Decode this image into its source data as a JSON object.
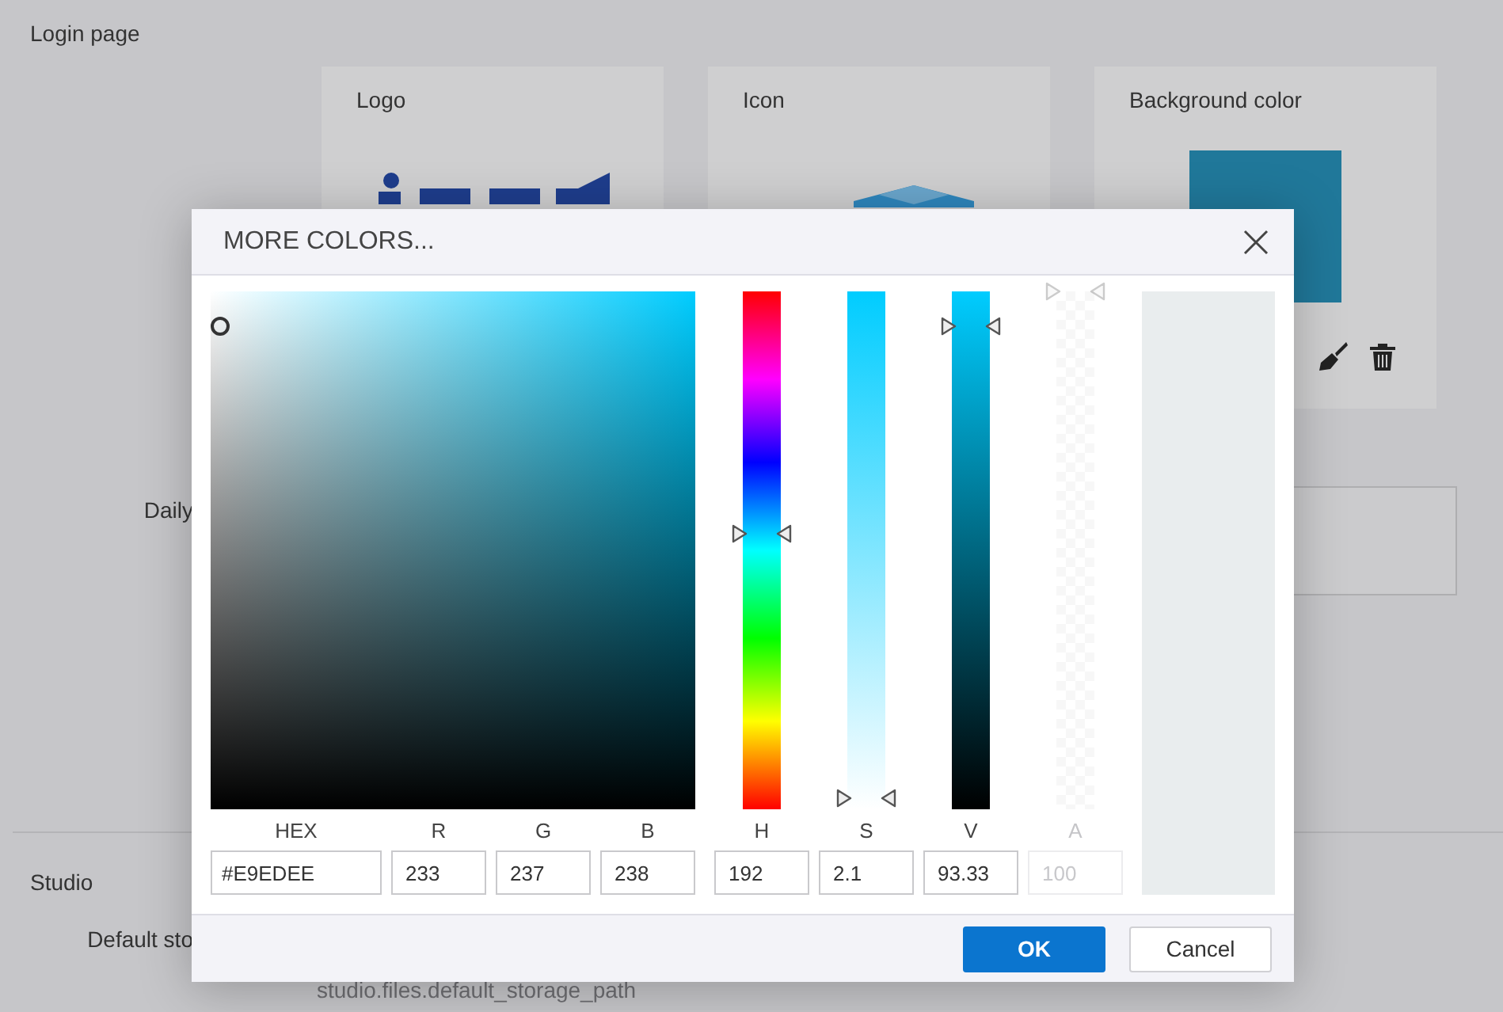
{
  "page": {
    "sections": [
      {
        "title": "Login page",
        "cards": [
          {
            "kind": "logo",
            "title": "Logo"
          },
          {
            "kind": "icon",
            "title": "Icon"
          },
          {
            "kind": "color",
            "title": "Background color",
            "color": "#20789a"
          }
        ],
        "field_label": "Daily"
      },
      {
        "title": "Studio",
        "field_label": "Default sto",
        "field_value": "studio.files.default_storage_path"
      }
    ]
  },
  "dialog": {
    "title": "MORE COLORS...",
    "fields": [
      {
        "label": "HEX",
        "value": "#E9EDEE"
      },
      {
        "label": "R",
        "value": "233"
      },
      {
        "label": "G",
        "value": "237"
      },
      {
        "label": "B",
        "value": "238"
      }
    ],
    "channels": [
      {
        "kind": "hue",
        "label": "H",
        "value": "192",
        "level": 0.533,
        "disabled": false
      },
      {
        "kind": "saturation",
        "label": "S",
        "value": "2.1",
        "level": 0.021,
        "disabled": false
      },
      {
        "kind": "value",
        "label": "V",
        "value": "93.33",
        "level": 0.933,
        "disabled": false
      },
      {
        "kind": "alpha",
        "label": "A",
        "value": "100",
        "level": 1,
        "disabled": true
      }
    ],
    "preview": {
      "color": "#e9edee"
    },
    "buttons": [
      {
        "kind": "primary",
        "label": "OK"
      },
      {
        "kind": "secondary",
        "label": "Cancel"
      }
    ]
  }
}
